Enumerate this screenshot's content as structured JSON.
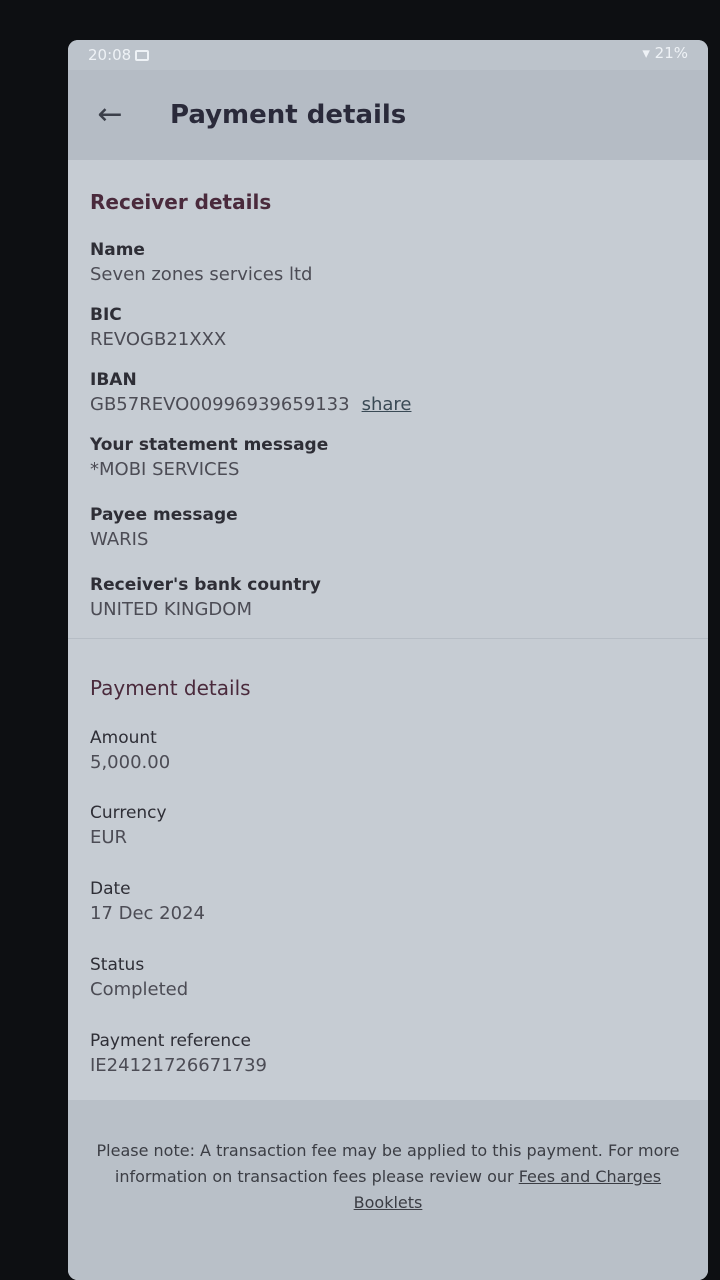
{
  "status_bar": {
    "time": "20:08",
    "battery": "21%"
  },
  "header": {
    "title": "Payment details"
  },
  "receiver": {
    "section_title": "Receiver details",
    "name_label": "Name",
    "name_value": "Seven zones services ltd",
    "bic_label": "BIC",
    "bic_value": "REVOGB21XXX",
    "iban_label": "IBAN",
    "iban_value": "GB57REVO00996939659133",
    "iban_share": "share",
    "statement_label": "Your statement message",
    "statement_value": "*MOBI SERVICES",
    "payee_label": "Payee message",
    "payee_value": "WARIS",
    "country_label": "Receiver's bank country",
    "country_value": "UNITED KINGDOM"
  },
  "payment": {
    "section_title": "Payment details",
    "amount_label": "Amount",
    "amount_value": "5,000.00",
    "currency_label": "Currency",
    "currency_value": "EUR",
    "date_label": "Date",
    "date_value": "17 Dec 2024",
    "status_label": "Status",
    "status_value": "Completed",
    "reference_label": "Payment reference",
    "reference_value": "IE24121726671739"
  },
  "note": {
    "text": "Please note: A transaction fee may be applied to this payment. For more information on transaction fees please review our ",
    "link": "Fees and Charges Booklets"
  }
}
